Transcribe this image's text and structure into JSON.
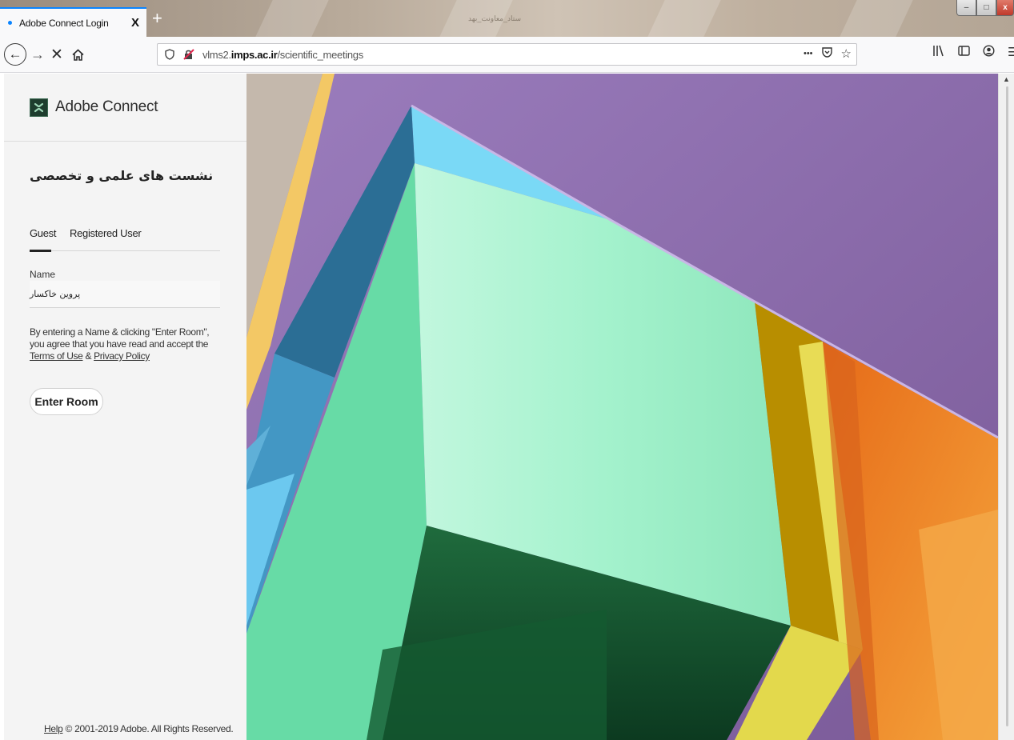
{
  "browser": {
    "tab_title": "Adobe Connect Login",
    "tab_close": "X",
    "new_tab": "+",
    "window_title": "ستاد_معاونت_بهد",
    "url_prefix": "vlms2.",
    "url_domain": "imps.ac.ir",
    "url_path": "/scientific_meetings",
    "more_icon": "•••",
    "win_min": "–",
    "win_max": "□",
    "win_close": "x"
  },
  "app": {
    "name": "Adobe Connect",
    "room_title": "نشست های علمی و تخصصی"
  },
  "login": {
    "tabs": [
      "Guest",
      "Registered User"
    ],
    "name_label": "Name",
    "name_value": "پروین خاکسار",
    "agreement_text": "By entering a Name & clicking \"Enter Room\", you agree that you have read and accept the ",
    "terms_link": "Terms of Use",
    "agreement_amp": " & ",
    "privacy_link": "Privacy Policy",
    "enter_button": "Enter Room"
  },
  "footer": {
    "help_link": "Help",
    "copyright": " © 2001-2019 Adobe. All Rights Reserved."
  },
  "colors": {
    "accent_tab": "#0a84ff",
    "hero_purple": "#8a6aa8",
    "hero_green": "#68dba5",
    "hero_mint": "#b0f5d6",
    "hero_yellow": "#e3d94c",
    "hero_orange": "#e87a1e",
    "hero_blue": "#5fc2e6"
  }
}
